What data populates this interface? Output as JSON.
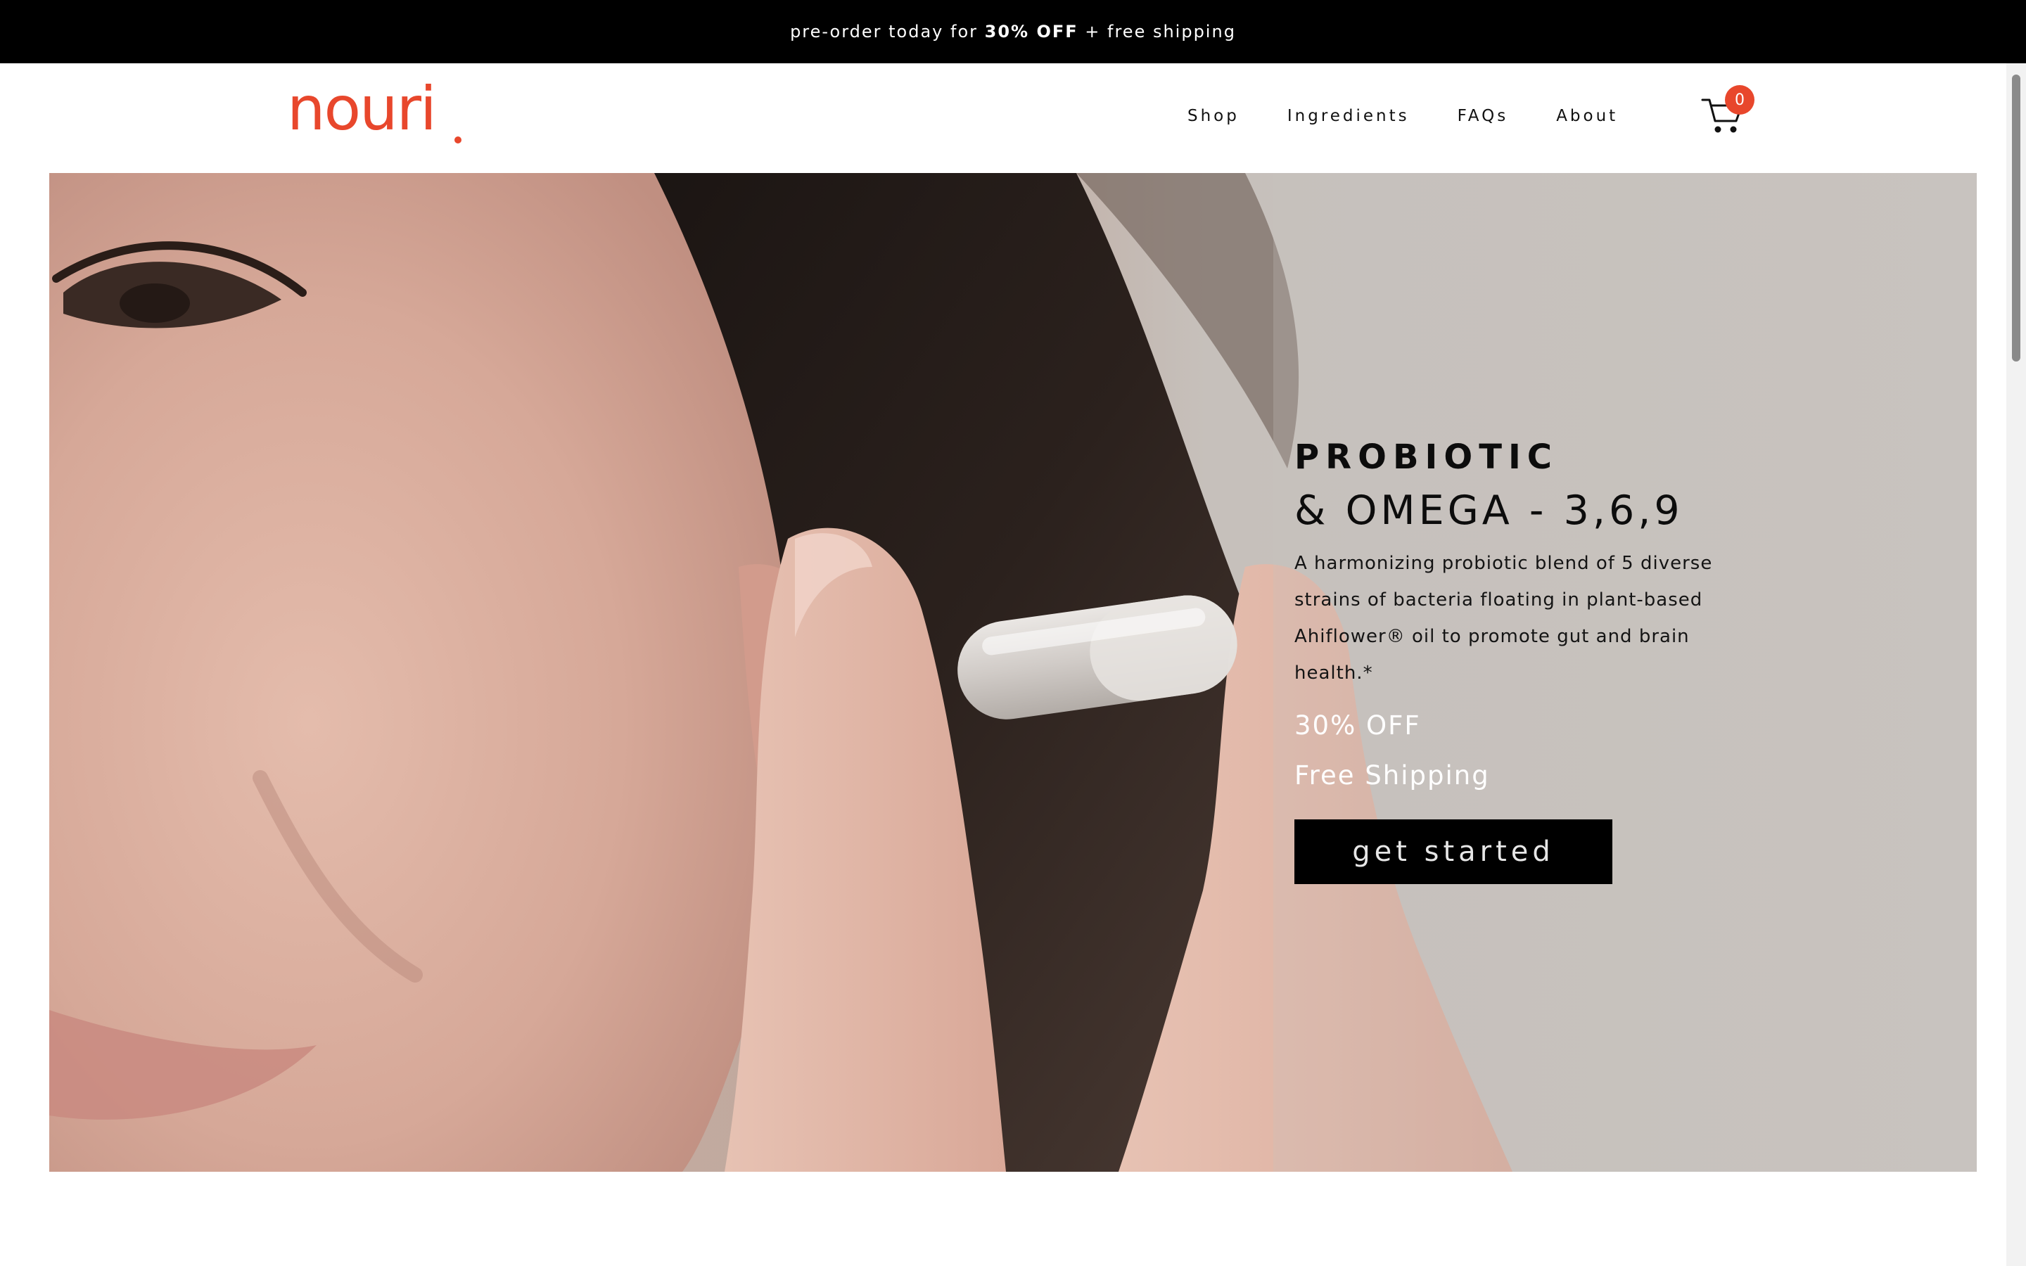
{
  "announcement": {
    "prefix": "pre-order today for ",
    "highlight": "30% OFF",
    "suffix": " + free shipping"
  },
  "header": {
    "logo": "nouri",
    "nav": [
      "Shop",
      "Ingredients",
      "FAQs",
      "About"
    ],
    "cart_count": "0"
  },
  "hero": {
    "title": "PROBIOTIC",
    "subtitle": "& OMEGA - 3,6,9",
    "description": "A harmonizing probiotic blend of 5 diverse strains of bacteria floating in plant-based Ahiflower® oil to promote gut and brain health.*",
    "offer": "30% OFF",
    "shipping": "Free Shipping",
    "cta": "get started"
  },
  "colors": {
    "brand": "#e8472c",
    "announcement_bg": "#000000",
    "cta_bg": "#000000",
    "hero_bg": "#c7c2be"
  },
  "icons": {
    "cart": "cart-icon"
  }
}
